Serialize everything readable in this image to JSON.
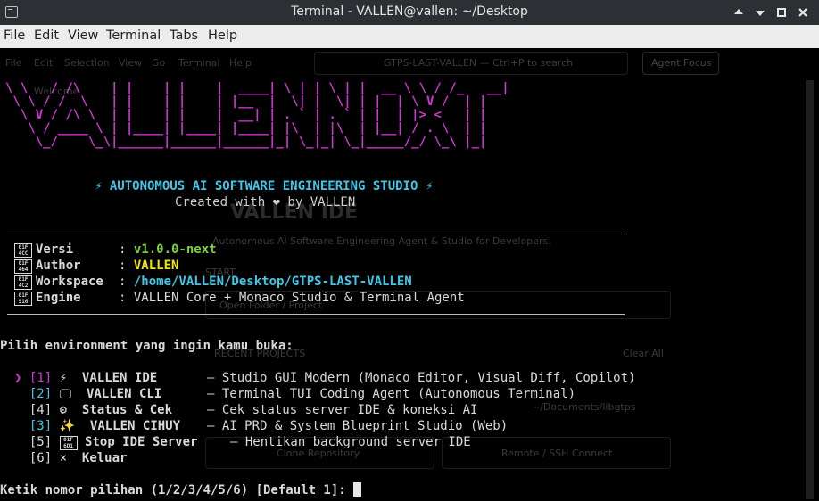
{
  "window": {
    "title": "Terminal - VALLEN@vallen: ~/Desktop"
  },
  "menu": [
    "File",
    "Edit",
    "View",
    "Terminal",
    "Tabs",
    "Help"
  ],
  "background_app": {
    "menu": [
      "File",
      "Edit",
      "Selection",
      "View",
      "Go",
      "Terminal",
      "Help"
    ],
    "search": "GTPS-LAST-VALLEN — Ctrl+P to search",
    "agent_focus": "Agent Focus",
    "welcome_tab": "Welcome",
    "logo": "VALLEN IDE",
    "tagline": "Autonomous AI Software Engineering Agent & Studio for Developers.",
    "start": "START",
    "open_folder": "Open Folder / Project",
    "recent": "RECENT PROJECTS",
    "clear_all": "Clear All",
    "recent_path": "~/Documents/libgtps",
    "clone": "Clone Repository",
    "remote": "Remote / SSH Connect"
  },
  "banner": {
    "art": "\\ \\   / /\\    | |    | |    |  ____| \\ | | \\ | |  __ \\ \\ / /_   __|\n \\ \\ / /  \\   | |    | |    | |__  |  \\| |  \\| | |  | \\ V /  | |\n  \\ V / /\\ \\  | |    | |    |  __| | . ` | . ` | |  | |> <   | |\n   \\ / ____ \\ | |____| |____| |____| |\\  | |\\  | |__| / . \\  | |\n    \\_/    \\_\\|______|______|______|_| \\_|_| \\_|_____/_/ \\_\\ |_|",
    "subtitle": "⚡ AUTONOMOUS AI SOFTWARE ENGINEERING STUDIO ⚡",
    "credit": "Created with ❤ by VALLEN"
  },
  "info": [
    {
      "icon": "01F4CC",
      "key": "Versi",
      "value": "v1.0.0-next",
      "color": "#7cd13b"
    },
    {
      "icon": "01F464",
      "key": "Author",
      "value": "VALLEN",
      "color": "#f2e600"
    },
    {
      "icon": "01F4C2",
      "key": "Workspace",
      "value": "/home/VALLEN/Desktop/GTPS-LAST-VALLEN",
      "color": "#3ec7e8"
    },
    {
      "icon": "01F916",
      "key": "Engine",
      "value": "VALLEN Core + Monaco Studio & Terminal Agent",
      "color": "#d9d9d9"
    }
  ],
  "prompt_heading": "Pilih environment yang ingin kamu buka:",
  "selector": "❯",
  "options": [
    {
      "num": "[1]",
      "icon": "⚡",
      "name": "VALLEN IDE",
      "desc": "— Studio GUI Modern (Monaco Editor, Visual Diff, Copilot)",
      "num_color": "#d336d6"
    },
    {
      "num": "[2]",
      "icon": "🖵",
      "name": "VALLEN CLI",
      "desc": "— Terminal TUI Coding Agent (Autonomous Terminal)",
      "num_color": "#3ec7e8"
    },
    {
      "num": "[4]",
      "icon": "⚙",
      "name": "Status & Cek",
      "desc": "— Cek status server IDE & koneksi AI",
      "num_color": "#d9d9d9"
    },
    {
      "num": "[3]",
      "icon": "✨",
      "name": "VALLEN CIHUY",
      "desc": "— AI PRD & System Blueprint Studio (Web)",
      "num_color": "#3ec7e8"
    },
    {
      "num": "[5]",
      "icon": "01F6D1",
      "name": "Stop IDE Server",
      "desc": "— Hentikan background server IDE",
      "num_color": "#d9d9d9"
    },
    {
      "num": "[6]",
      "icon": "×",
      "name": "Keluar",
      "desc": "",
      "num_color": "#d9d9d9"
    }
  ],
  "input_prompt": "Ketik nomor pilihan (1/2/3/4/5/6) [Default 1]: "
}
